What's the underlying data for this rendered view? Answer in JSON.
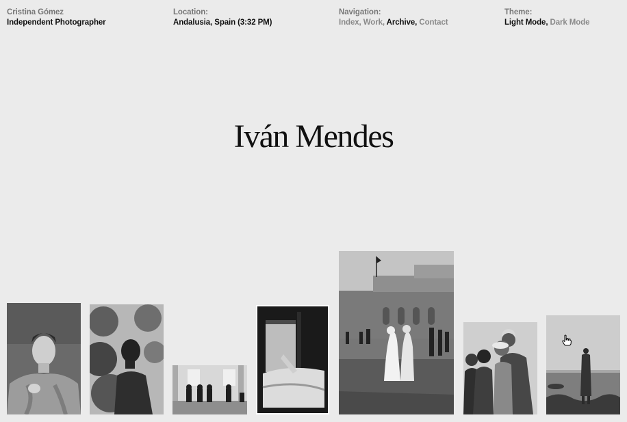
{
  "header": {
    "owner_name": "Cristina Gómez",
    "owner_role": "Independent Photographer",
    "location_label": "Location:",
    "location_value": "Andalusia, Spain (3:32 PM)",
    "nav_label": "Navigation:",
    "nav_items": [
      {
        "label": "Index,",
        "active": false
      },
      {
        "label": "Work,",
        "active": false
      },
      {
        "label": "Archive,",
        "active": true
      },
      {
        "label": "Contact",
        "active": false
      }
    ],
    "theme_label": "Theme:",
    "theme_options": [
      {
        "label": "Light Mode,",
        "active": true
      },
      {
        "label": "Dark Mode",
        "active": false
      }
    ]
  },
  "main": {
    "title": "Iván Mendes"
  },
  "gallery": {
    "photos": [
      {
        "subject": "portrait-young-man-knit-sweater"
      },
      {
        "subject": "shirtless-man-foliage"
      },
      {
        "subject": "men-sitting-against-wall"
      },
      {
        "subject": "bed-by-window"
      },
      {
        "subject": "women-white-robes-plaza"
      },
      {
        "subject": "boys-crowd-portrait"
      },
      {
        "subject": "figure-standing-seashore"
      }
    ]
  },
  "cursor": {
    "icon": "hand-pointer-icon"
  }
}
